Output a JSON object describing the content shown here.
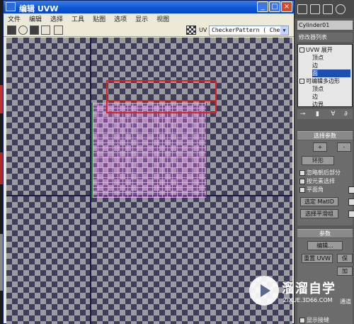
{
  "window": {
    "title": "编辑 UVW"
  },
  "menu": [
    "文件",
    "编辑",
    "选择",
    "工具",
    "贴图",
    "选项",
    "显示",
    "视图"
  ],
  "toolbar": {
    "uv_label": "UV",
    "texture_select": "CheckerPattern  ( Checker"
  },
  "command_panel": {
    "object_name": "Cylinder01",
    "modifier_list_label": "修改器列表",
    "stack": [
      {
        "label": "UVW 展开",
        "level": 0,
        "expanded": true,
        "selected": false
      },
      {
        "label": "顶点",
        "level": 1,
        "selected": false
      },
      {
        "label": "边",
        "level": 1,
        "selected": false
      },
      {
        "label": "面",
        "level": 1,
        "selected": true
      },
      {
        "label": "可编辑多边形",
        "level": 0,
        "expanded": true,
        "selected": false
      },
      {
        "label": "顶点",
        "level": 1,
        "selected": false
      },
      {
        "label": "边",
        "level": 1,
        "selected": false
      },
      {
        "label": "边界",
        "level": 1,
        "selected": false
      }
    ],
    "selection_rollout": {
      "title": "选择参数",
      "plus": "+",
      "minus": "-",
      "ring_label": "环形",
      "ignore_backfaces": "忽略朝后部分",
      "select_by_element": "按元素选择",
      "planar_angle": "平面角",
      "select_matid": "选定 MatID",
      "select_smoothing": "选择平滑组"
    },
    "params_rollout": {
      "title": "参数",
      "edit_button": "编辑...",
      "reset_uvw": "重置 UVW",
      "save_partial": "保",
      "load_partial": "加",
      "channel_label": "通道",
      "show_seam": "显示接缝"
    }
  },
  "watermark": {
    "name": "溜溜自学",
    "url": "ZIXUE.3D66.COM"
  }
}
